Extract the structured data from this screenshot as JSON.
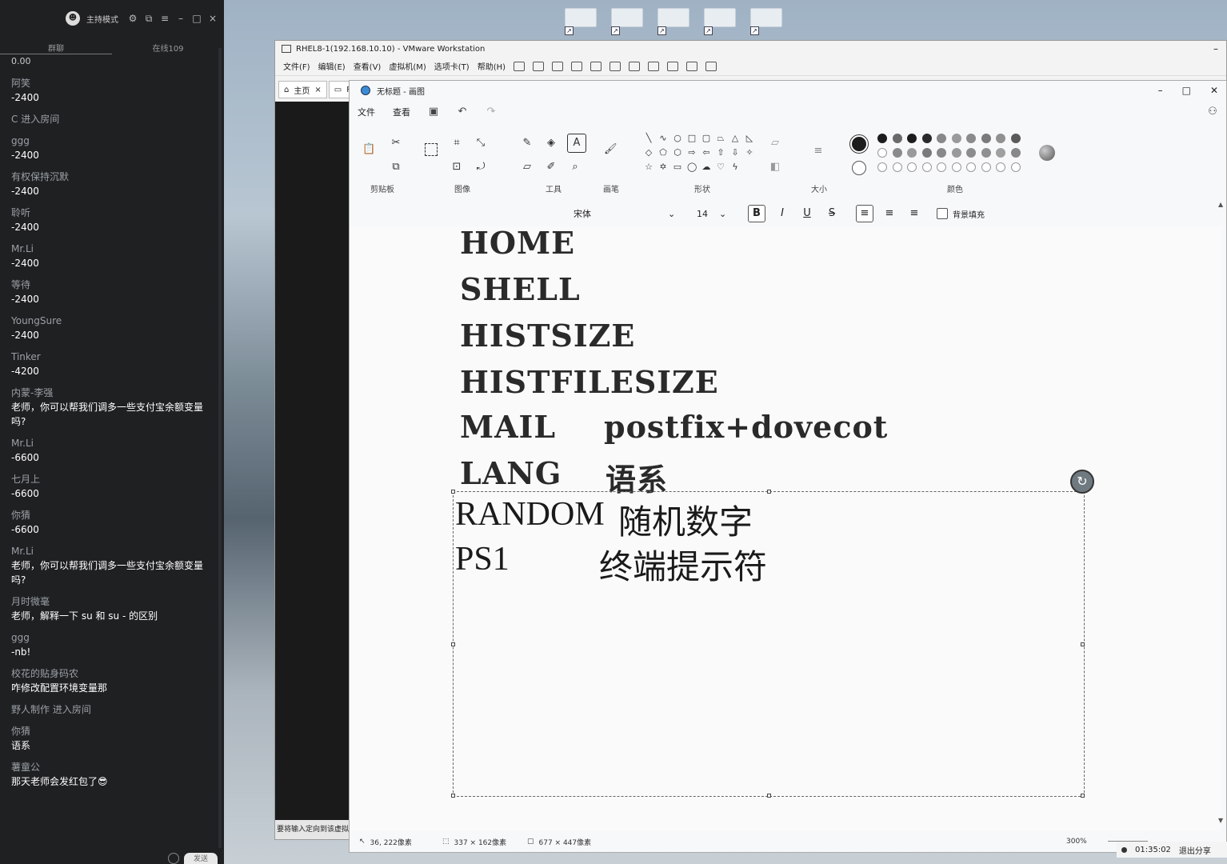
{
  "chat": {
    "mode_label": "主持模式",
    "tabs": [
      "群聊",
      "在线109"
    ],
    "top_partial": "0.00",
    "messages": [
      {
        "who": "阿笑",
        "text": "-2400"
      },
      {
        "who": "C 进入房间",
        "text": ""
      },
      {
        "who": "ggg",
        "text": "-2400"
      },
      {
        "who": "有权保持沉默",
        "text": "-2400"
      },
      {
        "who": "聆听",
        "text": "-2400"
      },
      {
        "who": "Mr.Li",
        "text": "-2400"
      },
      {
        "who": "等待",
        "text": "-2400"
      },
      {
        "who": "YoungSure",
        "text": "-2400"
      },
      {
        "who": "Tinker",
        "text": "-4200"
      },
      {
        "who": "内蒙-李强",
        "text": "老师，你可以帮我们调多一些支付宝余额变量吗?"
      },
      {
        "who": "Mr.Li",
        "text": "-6600"
      },
      {
        "who": "七月上",
        "text": "-6600"
      },
      {
        "who": "你猜",
        "text": "-6600"
      },
      {
        "who": "Mr.Li",
        "text": "老师，你可以帮我们调多一些支付宝余额变量吗?"
      },
      {
        "who": "月时微毫",
        "text": "老师，解释一下 su 和 su - 的区别"
      },
      {
        "who": "ggg",
        "text": "-nb!"
      },
      {
        "who": "校花的贴身码农",
        "text": "咋修改配置环境变量那"
      },
      {
        "who": "野人制作 进入房间",
        "text": ""
      },
      {
        "who": "你猜",
        "text": "语系"
      },
      {
        "who": "薯童公",
        "text": "那天老师会发红包了😎"
      }
    ],
    "send_label": "发送"
  },
  "vmware": {
    "title": "RHEL8-1(192.168.10.10) - VMware Workstation",
    "menu": [
      "文件(F)",
      "编辑(E)",
      "查看(V)",
      "虚拟机(M)",
      "选项卡(T)",
      "帮助(H)"
    ],
    "tabs": [
      "主页",
      "R"
    ],
    "status_text": "要将输入定向到该虚拟机"
  },
  "paint": {
    "title": "无标题 - 画图",
    "menu": [
      "文件",
      "查看"
    ],
    "groups": {
      "clipboard": "剪贴板",
      "image": "图像",
      "tools": "工具",
      "brushes": "画笔",
      "shapes": "形状",
      "size": "大小",
      "colors": "颜色"
    },
    "text_toolbar": {
      "font": "宋体",
      "size": "14",
      "bold": "B",
      "italic": "I",
      "underline": "U",
      "strike": "S",
      "bg_fill": "背景填充"
    },
    "canvas_lines": [
      {
        "left": "HOME",
        "right": ""
      },
      {
        "left": "SHELL",
        "right": ""
      },
      {
        "left": "HISTSIZE",
        "right": ""
      },
      {
        "left": "HISTFILESIZE",
        "right": ""
      },
      {
        "left": "MAIL",
        "right": "postfix+dovecot"
      },
      {
        "left": "LANG",
        "right": "语系"
      }
    ],
    "selected_lines": [
      {
        "left": "RANDOM",
        "right": "随机数字"
      },
      {
        "left": "PS1",
        "right": "终端提示符"
      }
    ],
    "status": {
      "cursor": "36, 222像素",
      "selection": "337 × 162像素",
      "canvas": "677 × 447像素",
      "zoom": "300%"
    },
    "palette": [
      "#1c1c1c",
      "#6a6a6a",
      "#1c1c1c",
      "#2a2a2a",
      "#888888",
      "#9a9a9a",
      "#8a8a8a",
      "#7a7a7a",
      "#909090",
      "#5a5a5a",
      "#7d7d7d"
    ]
  },
  "sharebar": {
    "time": "01:35:02",
    "exit": "退出分享"
  }
}
